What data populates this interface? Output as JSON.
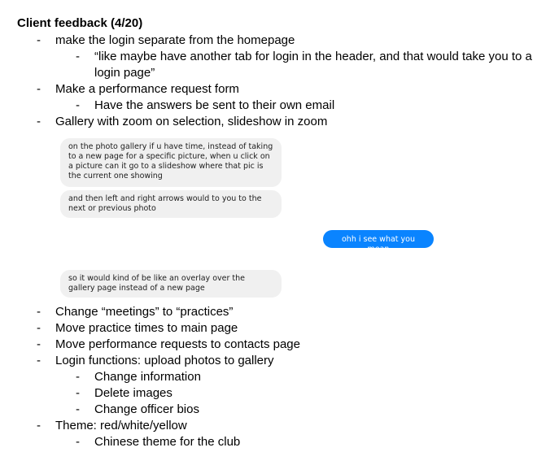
{
  "title": "Client feedback (4/20)",
  "bullets_top": [
    {
      "level": 1,
      "text": "make the login separate from the homepage"
    },
    {
      "level": 2,
      "text": "“like maybe have another tab for login in the header, and that would take you to a login page”"
    },
    {
      "level": 1,
      "text": "Make a performance request form"
    },
    {
      "level": 2,
      "text": "Have the answers be sent to their own email"
    },
    {
      "level": 1,
      "text": "Gallery with zoom on selection, slideshow in zoom"
    }
  ],
  "dash": "-",
  "chat": {
    "messages": [
      {
        "side": "in",
        "text": "on the photo gallery if u have time, instead of taking to a new page for a specific picture, when u click on a picture can it go to a slideshow where that pic is the current one showing"
      },
      {
        "side": "in",
        "text": "and then left and right arrows would to you to the next or previous photo"
      },
      {
        "side": "out",
        "text": "ohh i see what you mean"
      },
      {
        "side": "in",
        "text": "so it would kind of be like an overlay over the gallery page instead of a new page"
      }
    ],
    "colors": {
      "incoming_bg": "#f0f0f0",
      "outgoing_bg": "#0a84ff"
    }
  },
  "bullets_bottom": [
    {
      "level": 1,
      "text": "Change “meetings” to “practices”"
    },
    {
      "level": 1,
      "text": "Move practice times to main page"
    },
    {
      "level": 1,
      "text": "Move performance requests to contacts page"
    },
    {
      "level": 1,
      "text": "Login functions: upload photos to gallery"
    },
    {
      "level": 2,
      "text": "Change information"
    },
    {
      "level": 2,
      "text": "Delete images"
    },
    {
      "level": 2,
      "text": "Change officer bios"
    },
    {
      "level": 1,
      "text": "Theme: red/white/yellow"
    },
    {
      "level": 2,
      "text": "Chinese theme for the club"
    }
  ]
}
